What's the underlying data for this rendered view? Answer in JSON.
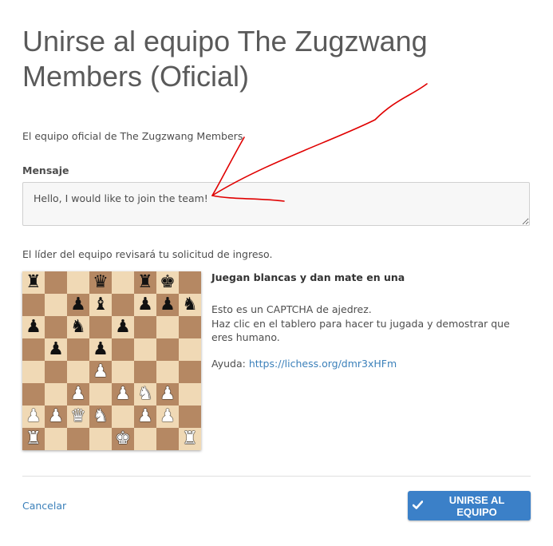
{
  "page": {
    "title": "Unirse al equipo The Zugzwang Members (Oficial)",
    "description": "El equipo oficial de The Zugzwang Members",
    "message_label": "Mensaje",
    "message_value": "Hello, I would like to join the team!",
    "review_note": "El líder del equipo revisará tu solicitud de ingreso."
  },
  "captcha": {
    "title": "Juegan blancas y dan mate en una",
    "line1": "Esto es un CAPTCHA de ajedrez.",
    "line2": "Haz clic en el tablero para hacer tu jugada y demostrar que eres humano.",
    "help_label": "Ayuda:",
    "help_link": "https://lichess.org/dmr3xHFm",
    "board": [
      [
        "bR",
        "",
        "",
        "bQ",
        "",
        "bR",
        "bK",
        ""
      ],
      [
        "",
        "",
        "bP",
        "bB",
        "",
        "bP",
        "bP",
        "bN"
      ],
      [
        "bP",
        "",
        "bN",
        "",
        "bP",
        "",
        "",
        ""
      ],
      [
        "",
        "bP",
        "",
        "bP",
        "",
        "",
        "",
        ""
      ],
      [
        "",
        "",
        "",
        "wP",
        "",
        "",
        "",
        ""
      ],
      [
        "",
        "",
        "wP",
        "",
        "wP",
        "wN",
        "wP",
        ""
      ],
      [
        "wP",
        "wP",
        "wQ",
        "wN",
        "",
        "wP",
        "wP",
        ""
      ],
      [
        "wR",
        "",
        "",
        "",
        "wK",
        "",
        "",
        "wR"
      ]
    ]
  },
  "footer": {
    "cancel_label": "Cancelar",
    "join_label": "UNIRSE AL EQUIPO",
    "join_icon": "checkmark-icon"
  },
  "colors": {
    "link": "#3b80ba",
    "button": "#3b80c8",
    "light_square": "#f0d9b5",
    "dark_square": "#b58863",
    "annotation": "#e00000"
  }
}
